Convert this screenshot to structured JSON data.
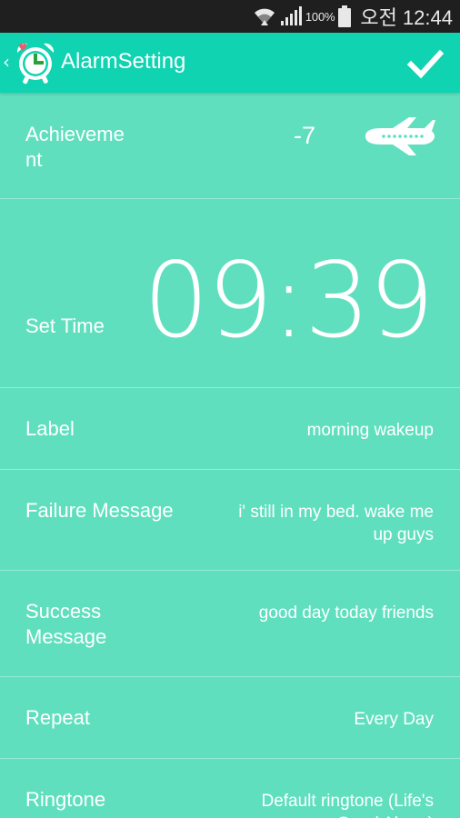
{
  "status_bar": {
    "battery_percent": "100%",
    "time": "오전 12:44",
    "icons": [
      "wifi-icon",
      "signal-icon",
      "battery-icon"
    ]
  },
  "app_bar": {
    "title": "AlarmSetting",
    "back_glyph": "‹",
    "icons": [
      "alarm-clock-logo-icon",
      "checkmark-icon"
    ]
  },
  "settings": {
    "achievement": {
      "label": "Achieveme\nnt",
      "value": "-7",
      "icon": "airplane-icon"
    },
    "set_time": {
      "label": "Set Time",
      "value": "09:39"
    },
    "label": {
      "label": "Label",
      "value": "morning wakeup"
    },
    "failure_message": {
      "label": "Failure Message",
      "value": "i' still in my bed. wake me\nup guys"
    },
    "success_message": {
      "label": "Success\nMessage",
      "value": "good day today friends"
    },
    "repeat": {
      "label": "Repeat",
      "value": "Every Day"
    },
    "ringtone": {
      "label": "Ringtone",
      "value": "Default ringtone (Life's\nGood Alarm)"
    }
  },
  "colors": {
    "background": "#60dfbf",
    "app_bar": "#0fd3b1",
    "status_bar": "#1f1f1f",
    "text": "#ffffff"
  }
}
